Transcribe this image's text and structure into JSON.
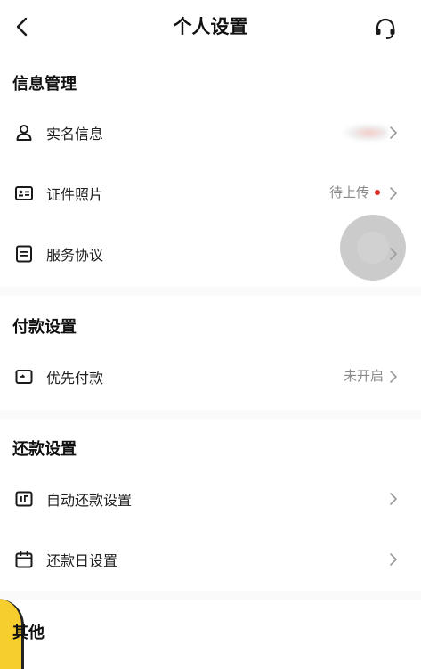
{
  "header": {
    "title": "个人设置",
    "back_icon": "chevron-left-icon",
    "support_icon": "headset-icon"
  },
  "sections": {
    "info": {
      "title": "信息管理",
      "items": [
        {
          "label": "实名信息",
          "icon": "user-icon"
        },
        {
          "label": "证件照片",
          "value": "待上传",
          "icon": "id-card-icon"
        },
        {
          "label": "服务协议",
          "icon": "document-icon"
        }
      ]
    },
    "payment": {
      "title": "付款设置",
      "items": [
        {
          "label": "优先付款",
          "value": "未开启",
          "icon": "wallet-icon"
        }
      ]
    },
    "repay": {
      "title": "还款设置",
      "items": [
        {
          "label": "自动还款设置",
          "icon": "auto-repay-icon"
        },
        {
          "label": "还款日设置",
          "icon": "calendar-icon"
        }
      ]
    },
    "other": {
      "title": "其他"
    }
  },
  "colors": {
    "badge_dot": "#e0302d",
    "secondary_text": "#8a8a8a"
  }
}
